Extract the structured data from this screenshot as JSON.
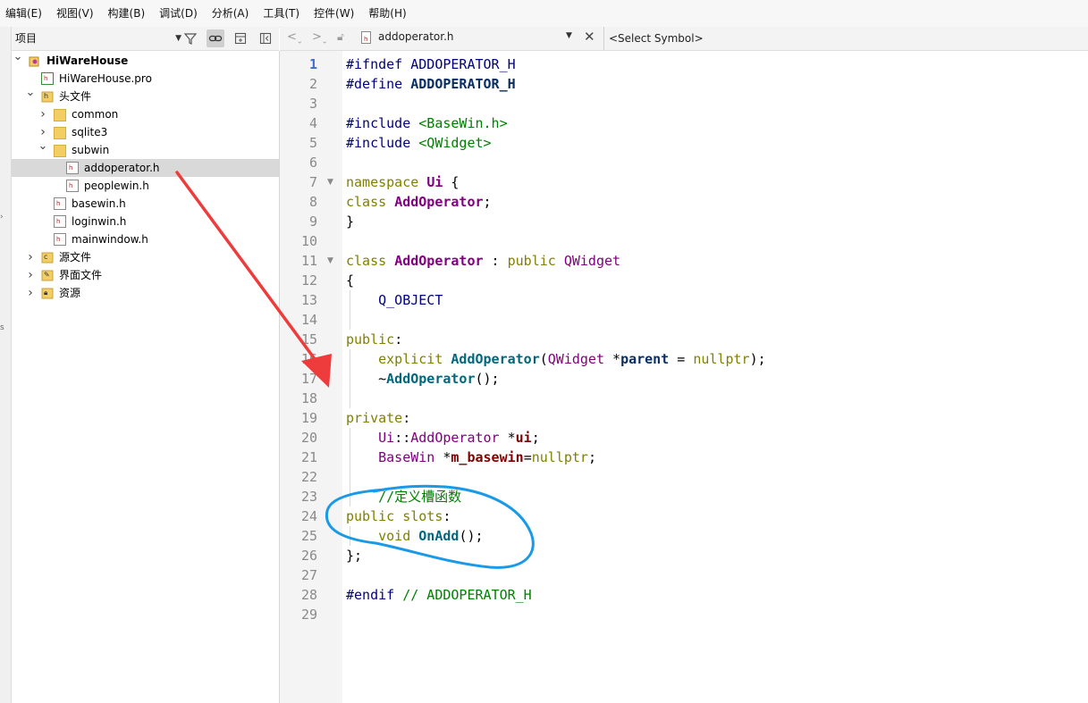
{
  "menu": [
    "编辑(E)",
    "视图(V)",
    "构建(B)",
    "调试(D)",
    "分析(A)",
    "工具(T)",
    "控件(W)",
    "帮助(H)"
  ],
  "sidebar": {
    "selector": "项目",
    "tree": [
      {
        "label": "HiWareHouse",
        "level": 0,
        "chev": "v",
        "icon": "project-icon",
        "bold": true
      },
      {
        "label": "HiWareHouse.pro",
        "level": 1,
        "chev": "",
        "icon": "pro-file-icon"
      },
      {
        "label": "头文件",
        "level": 1,
        "chev": "v",
        "icon": "header-folder-icon"
      },
      {
        "label": "common",
        "level": 2,
        "chev": ">",
        "icon": "folder-icon"
      },
      {
        "label": "sqlite3",
        "level": 2,
        "chev": ">",
        "icon": "folder-icon"
      },
      {
        "label": "subwin",
        "level": 2,
        "chev": "v",
        "icon": "folder-icon"
      },
      {
        "label": "addoperator.h",
        "level": 3,
        "chev": "",
        "icon": "header-file-icon",
        "selected": true
      },
      {
        "label": "peoplewin.h",
        "level": 3,
        "chev": "",
        "icon": "header-file-icon"
      },
      {
        "label": "basewin.h",
        "level": 2,
        "chev": "",
        "icon": "header-file-icon"
      },
      {
        "label": "loginwin.h",
        "level": 2,
        "chev": "",
        "icon": "header-file-icon"
      },
      {
        "label": "mainwindow.h",
        "level": 2,
        "chev": "",
        "icon": "header-file-icon"
      },
      {
        "label": "源文件",
        "level": 1,
        "chev": ">",
        "icon": "source-folder-icon"
      },
      {
        "label": "界面文件",
        "level": 1,
        "chev": ">",
        "icon": "form-folder-icon"
      },
      {
        "label": "资源",
        "level": 1,
        "chev": ">",
        "icon": "resource-folder-icon"
      }
    ]
  },
  "editor": {
    "file_name": "addoperator.h",
    "symbol": "<Select Symbol>",
    "current_line": 1,
    "fold_lines": [
      7,
      11
    ],
    "lines": [
      [
        [
          "#ifndef ",
          "pp"
        ],
        [
          "ADDOPERATOR_H",
          "mac"
        ]
      ],
      [
        [
          "#define ",
          "pp"
        ],
        [
          "ADDOPERATOR_H",
          "var"
        ]
      ],
      [],
      [
        [
          "#include ",
          "pp"
        ],
        [
          "<BaseWin.h>",
          "str"
        ]
      ],
      [
        [
          "#include ",
          "pp"
        ],
        [
          "<QWidget>",
          "str"
        ]
      ],
      [],
      [
        [
          "namespace ",
          "kw"
        ],
        [
          "Ui",
          "cls"
        ],
        [
          " {",
          ""
        ]
      ],
      [
        [
          "class ",
          "kw"
        ],
        [
          "AddOperator",
          "cls"
        ],
        [
          ";",
          ""
        ]
      ],
      [
        [
          "}",
          ""
        ]
      ],
      [],
      [
        [
          "class ",
          "kw"
        ],
        [
          "AddOperator",
          "cls"
        ],
        [
          " : ",
          ""
        ],
        [
          "public ",
          "kw"
        ],
        [
          "QWidget",
          "typ"
        ]
      ],
      [
        [
          "{",
          ""
        ]
      ],
      [
        [
          "    ",
          ""
        ],
        [
          "Q_OBJECT",
          "mac"
        ]
      ],
      [],
      [
        [
          "public",
          "kw"
        ],
        [
          ":",
          ""
        ]
      ],
      [
        [
          "    ",
          ""
        ],
        [
          "explicit ",
          "kw"
        ],
        [
          "AddOperator",
          "fn"
        ],
        [
          "(",
          ""
        ],
        [
          "QWidget",
          "typ"
        ],
        [
          " *",
          ""
        ],
        [
          "parent",
          "var"
        ],
        [
          " = ",
          ""
        ],
        [
          "nullptr",
          "kw"
        ],
        [
          ");",
          ""
        ]
      ],
      [
        [
          "    ~",
          ""
        ],
        [
          "AddOperator",
          "fn"
        ],
        [
          "();",
          ""
        ]
      ],
      [],
      [
        [
          "private",
          "kw"
        ],
        [
          ":",
          ""
        ]
      ],
      [
        [
          "    ",
          ""
        ],
        [
          "Ui",
          "typ"
        ],
        [
          "::",
          ""
        ],
        [
          "AddOperator",
          "typ"
        ],
        [
          " *",
          ""
        ],
        [
          "ui",
          "mem"
        ],
        [
          ";",
          ""
        ]
      ],
      [
        [
          "    ",
          ""
        ],
        [
          "BaseWin",
          "typ"
        ],
        [
          " *",
          ""
        ],
        [
          "m_basewin",
          "mem"
        ],
        [
          "=",
          ""
        ],
        [
          "nullptr",
          "kw"
        ],
        [
          ";",
          ""
        ]
      ],
      [],
      [
        [
          "    ",
          ""
        ],
        [
          "//定义槽函数",
          "cm"
        ]
      ],
      [
        [
          "public ",
          "kw"
        ],
        [
          "slots",
          "kw"
        ],
        [
          ":",
          ""
        ]
      ],
      [
        [
          "    ",
          ""
        ],
        [
          "void ",
          "kw"
        ],
        [
          "OnAdd",
          "fn"
        ],
        [
          "();",
          ""
        ]
      ],
      [
        [
          "};",
          ""
        ]
      ],
      [],
      [
        [
          "#endif ",
          "pp"
        ],
        [
          "// ADDOPERATOR_H",
          "cm"
        ]
      ],
      []
    ]
  },
  "annotations": {
    "arrow_color": "#ee3b3b",
    "circle_color": "#1a9ae6"
  }
}
